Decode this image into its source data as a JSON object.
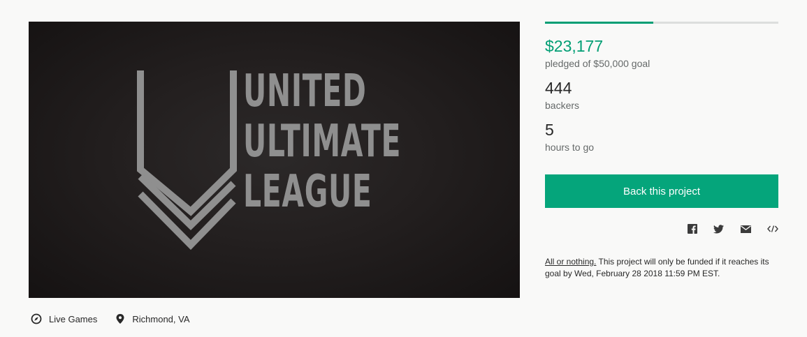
{
  "video": {
    "logo_lines": [
      "UNITED",
      "ULTIMATE",
      "LEAGUE"
    ],
    "background_color": "#1b1717",
    "logo_color": "#8f8f8f"
  },
  "meta": {
    "category": {
      "icon": "compass-icon",
      "label": "Live Games"
    },
    "location": {
      "icon": "map-pin-icon",
      "label": "Richmond, VA"
    }
  },
  "funding": {
    "progress_fraction": 0.4635,
    "pledged_amount": "$23,177",
    "pledged_label": "pledged of $50,000 goal",
    "backers_count": "444",
    "backers_label": "backers",
    "time_value": "5",
    "time_label": "hours to go"
  },
  "cta": {
    "back_label": "Back this project"
  },
  "share_icons": [
    "facebook-icon",
    "twitter-icon",
    "email-icon",
    "embed-code-icon"
  ],
  "note": {
    "lead": "All or nothing.",
    "text": " This project will only be funded if it reaches its goal by Wed, February 28 2018 11:59 PM EST."
  },
  "colors": {
    "accent": "#009e74",
    "button": "#05a57b",
    "progress_track": "#dcdedd",
    "muted_text": "#656969"
  }
}
